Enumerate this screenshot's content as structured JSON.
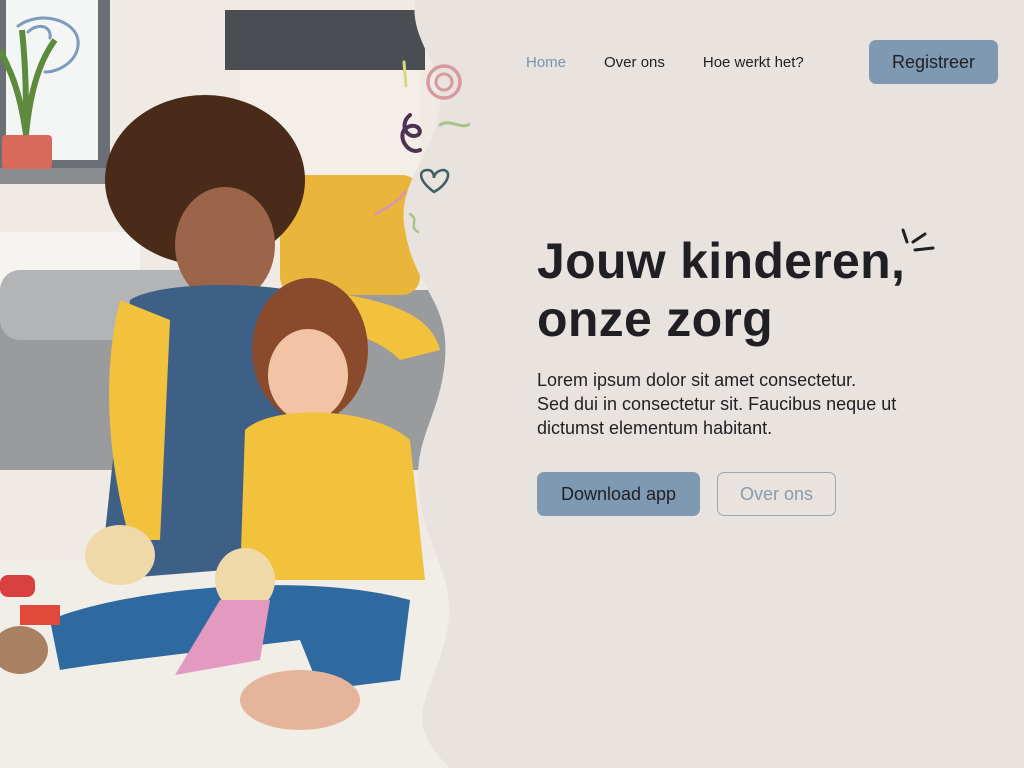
{
  "nav": {
    "items": [
      {
        "label": "Home",
        "active": true
      },
      {
        "label": "Over ons",
        "active": false
      },
      {
        "label": "Hoe werkt het?",
        "active": false
      }
    ],
    "register_label": "Registreer"
  },
  "hero": {
    "title_line1": "Jouw kinderen,",
    "title_line2": "onze zorg",
    "text_line1": "Lorem ipsum dolor sit amet consectetur.",
    "text_line2": "Sed dui in consectetur sit. Faucibus neque ut",
    "text_line3": "dictumst elementum habitant.",
    "primary_label": "Download app",
    "secondary_label": "Over ons"
  },
  "colors": {
    "background": "#e8e3de",
    "accent": "#8099b3",
    "active_link": "#7a93ad",
    "text": "#1f1f24"
  },
  "photo": {
    "description_icon": "photo-woman-and-girl-playing"
  }
}
